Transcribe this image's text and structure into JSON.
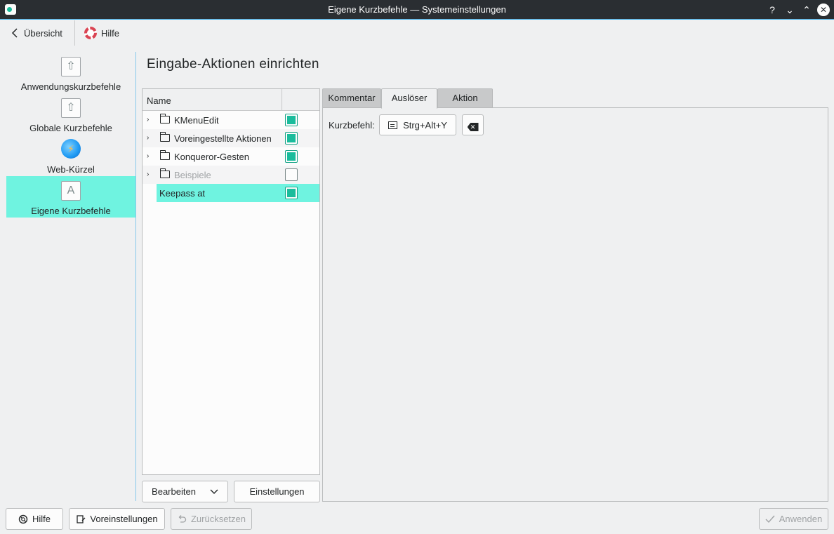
{
  "window": {
    "title": "Eigene Kurzbefehle  — Systemeinstellungen",
    "buttons": {
      "help": "?",
      "minimize": "⌄",
      "maximize": "⌃",
      "close": "✕"
    }
  },
  "toolbar": {
    "back_label": "Übersicht",
    "help_label": "Hilfe"
  },
  "sidebar": {
    "items": [
      {
        "label": "Anwendungskurzbefehle",
        "icon": "⇧",
        "active": false
      },
      {
        "label": "Globale Kurzbefehle",
        "icon": "⇧",
        "active": false
      },
      {
        "label": "Web-Kürzel",
        "icon": "⚡",
        "active": false
      },
      {
        "label": "Eigene Kurzbefehle",
        "icon": "A",
        "active": true
      }
    ]
  },
  "main": {
    "title": "Eingabe-Aktionen einrichten"
  },
  "tree": {
    "column_name": "Name",
    "rows": [
      {
        "name": "KMenuEdit",
        "checked": true,
        "folder": true,
        "enabled": true
      },
      {
        "name": "Voreingestellte Aktionen",
        "checked": true,
        "folder": true,
        "enabled": true
      },
      {
        "name": "Konqueror-Gesten",
        "checked": true,
        "folder": true,
        "enabled": true
      },
      {
        "name": "Beispiele",
        "checked": false,
        "folder": true,
        "enabled": false
      },
      {
        "name": "Keepass at",
        "checked": true,
        "folder": false,
        "enabled": true,
        "selected": true
      }
    ],
    "edit_button": "Bearbeiten",
    "settings_button": "Einstellungen"
  },
  "tabs": {
    "items": [
      "Kommentar",
      "Auslöser",
      "Aktion"
    ],
    "active": "Auslöser"
  },
  "trigger": {
    "shortcut_label": "Kurzbefehl:",
    "shortcut_value": "Strg+Alt+Y"
  },
  "footer": {
    "help": "Hilfe",
    "defaults": "Voreinstellungen",
    "reset": "Zurücksetzen",
    "apply": "Anwenden"
  },
  "colors": {
    "accent": "#3daee9",
    "selection": "#6ff3e0",
    "check": "#1abc9c",
    "titlebar": "#2a2e32"
  }
}
